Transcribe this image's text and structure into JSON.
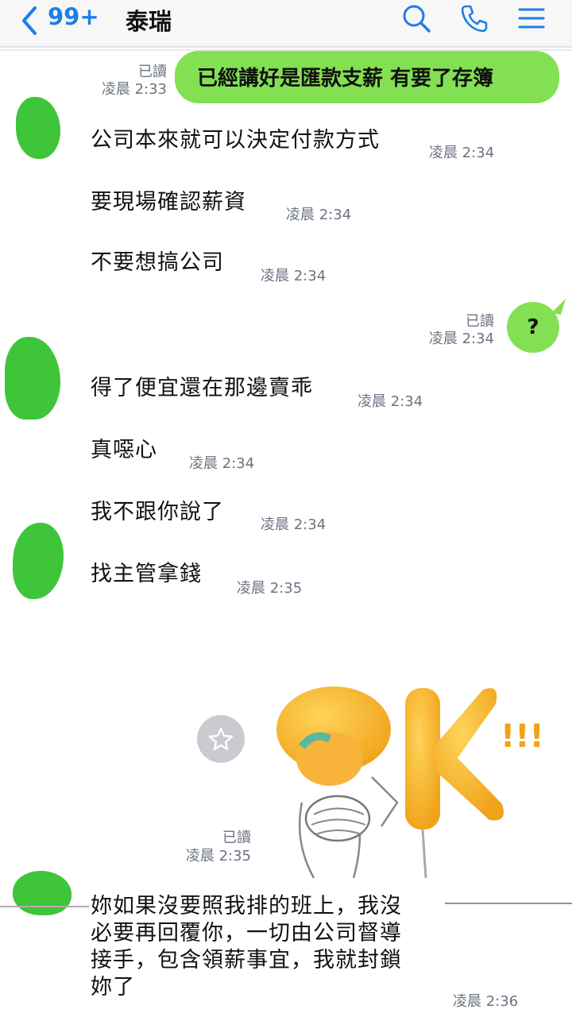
{
  "header": {
    "unread_count": "99+",
    "contact_name": "泰瑞",
    "icons": [
      "back-chevron-icon",
      "search-icon",
      "phone-icon",
      "menu-icon"
    ],
    "accent_color": "#1e7ee8"
  },
  "messages": {
    "m1": {
      "text": "已經講好是匯款支薪 有要了存簿",
      "read": "已讀",
      "time": "凌晨 2:33"
    },
    "m2": {
      "text": "公司本來就可以決定付款方式",
      "time": "凌晨 2:34"
    },
    "m3": {
      "text": "要現場確認薪資",
      "time": "凌晨 2:34"
    },
    "m4": {
      "text": "不要想搞公司",
      "time": "凌晨 2:34"
    },
    "m5": {
      "text": "?",
      "read": "已讀",
      "time": "凌晨 2:34"
    },
    "m6": {
      "text": "得了便宜還在那邊賣乖",
      "time": "凌晨 2:34"
    },
    "m7": {
      "text": "真噁心",
      "time": "凌晨 2:34"
    },
    "m8": {
      "text": "我不跟你說了",
      "time": "凌晨 2:34"
    },
    "m9": {
      "text": "找主管拿錢",
      "time": "凌晨 2:35"
    },
    "sticker": {
      "read": "已讀",
      "time": "凌晨 2:35",
      "exclaim": "!!!"
    },
    "m10": {
      "line1": "妳如果沒要照我排的班上，我沒",
      "line2": "必要再回覆你，一切由公司督導",
      "line3": "接手，包含領薪事宜，我就封鎖",
      "line4": "妳了",
      "time": "凌晨 2:36"
    }
  },
  "colors": {
    "my_bubble": "#84e053",
    "avatar_redaction": "#3fc53a"
  }
}
